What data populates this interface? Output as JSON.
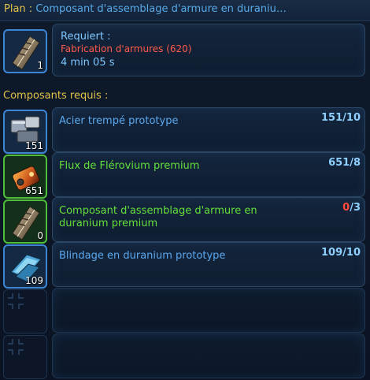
{
  "plan": {
    "prefix": "Plan : ",
    "name": "Composant d'assemblage d'armure en duraniu…"
  },
  "result": {
    "icon": "armor-assembly-component-icon",
    "quantity": "1",
    "requires_label": "Requiert :",
    "skill": "Fabrication d'armures (620)",
    "time": "4 min 05 s"
  },
  "components_label": "Composants requis :",
  "components": [
    {
      "name": "Acier trempé prototype",
      "icon": "tempered-steel-icon",
      "inventory": "151",
      "have": "151",
      "need": "10",
      "quality": "prototype",
      "name_color": "#5aa9f0"
    },
    {
      "name": "Flux de Flérovium premium",
      "icon": "flerovium-flux-icon",
      "inventory": "651",
      "have": "651",
      "need": "8",
      "quality": "premium",
      "name_color": "#63e03a"
    },
    {
      "name": "Composant d'assemblage d'armure en duranium premium",
      "icon": "armor-assembly-component-icon",
      "inventory": "0",
      "have": "0",
      "need": "3",
      "quality": "premium",
      "name_color": "#63e03a"
    },
    {
      "name": "Blindage en duranium prototype",
      "icon": "duranium-plating-icon",
      "inventory": "109",
      "have": "109",
      "need": "10",
      "quality": "prototype",
      "name_color": "#5aa9f0"
    }
  ],
  "empty_slots": 2,
  "colors": {
    "title_prefix": "#e2c24b",
    "title_name": "#57a9e8",
    "insufficient": "#ff4a3a",
    "prototype": "#5aa9f0",
    "premium": "#63e03a"
  }
}
